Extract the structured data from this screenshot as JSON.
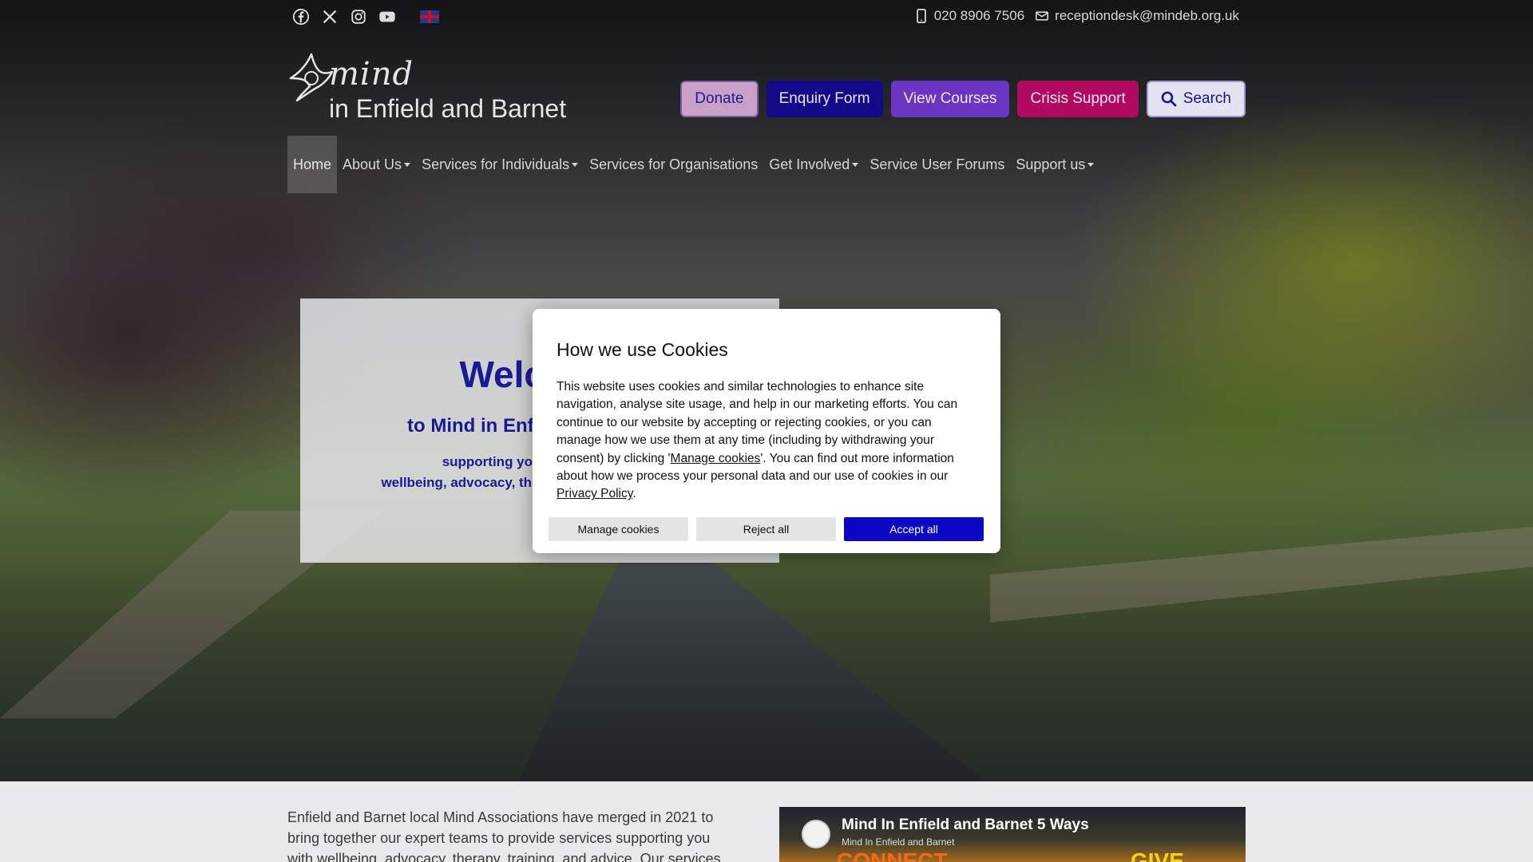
{
  "topbar": {
    "social": [
      {
        "icon": "facebook-icon"
      },
      {
        "icon": "x-twitter-icon"
      },
      {
        "icon": "instagram-icon"
      },
      {
        "icon": "youtube-icon"
      },
      {
        "icon": "uk-flag-icon"
      }
    ],
    "phone": "020 8906 7506",
    "email": "receptiondesk@mindeb.org.uk"
  },
  "logo": {
    "mind": "mind",
    "sub": "in Enfield and Barnet"
  },
  "actions": {
    "donate": "Donate",
    "enquiry": "Enquiry Form",
    "courses": "View Courses",
    "crisis": "Crisis Support",
    "search": "Search"
  },
  "nav": {
    "home": "Home",
    "about": "About Us",
    "individuals": "Services for Individuals",
    "organisations": "Services for Organisations",
    "involved": "Get Involved",
    "forums": "Service User Forums",
    "support": "Support us"
  },
  "welcome": {
    "title": "Welcome",
    "subtitle": "to Mind in Enfield and Barnet",
    "line1": "supporting your mental health",
    "line2": "wellbeing, advocacy, therapy, training and advice"
  },
  "cookie": {
    "title": "How we use Cookies",
    "text_1": "This website uses cookies and similar technologies to enhance site navigation, analyse site usage, and help in our marketing efforts. You can continue to our website by accepting or rejecting cookies, or you can manage how we use them at any time (including by withdrawing your consent) by clicking '",
    "link_manage": "Manage cookies",
    "text_2": "'. You can find out more information about how we process your personal data and our use of cookies in our ",
    "link_privacy": "Privacy Policy",
    "text_3": ".",
    "btn_manage": "Manage cookies",
    "btn_reject": "Reject all",
    "btn_accept": "Accept all"
  },
  "intro": {
    "text": "Enfield and Barnet local Mind Associations have merged in 2021 to bring together our expert teams to provide services supporting you with wellbeing, advocacy, therapy, training, and advice. Our services"
  },
  "video": {
    "title": "Mind In Enfield and Barnet 5 Ways",
    "channel": "Mind In Enfield and Barnet",
    "word1": "CONNECT",
    "word2": "GIVE"
  },
  "colors": {
    "brand_navy": "#1a1a95",
    "enquiry": "#130a8a",
    "courses": "#6a35c2",
    "crisis": "#b00a60",
    "accept": "#0b07c4"
  }
}
